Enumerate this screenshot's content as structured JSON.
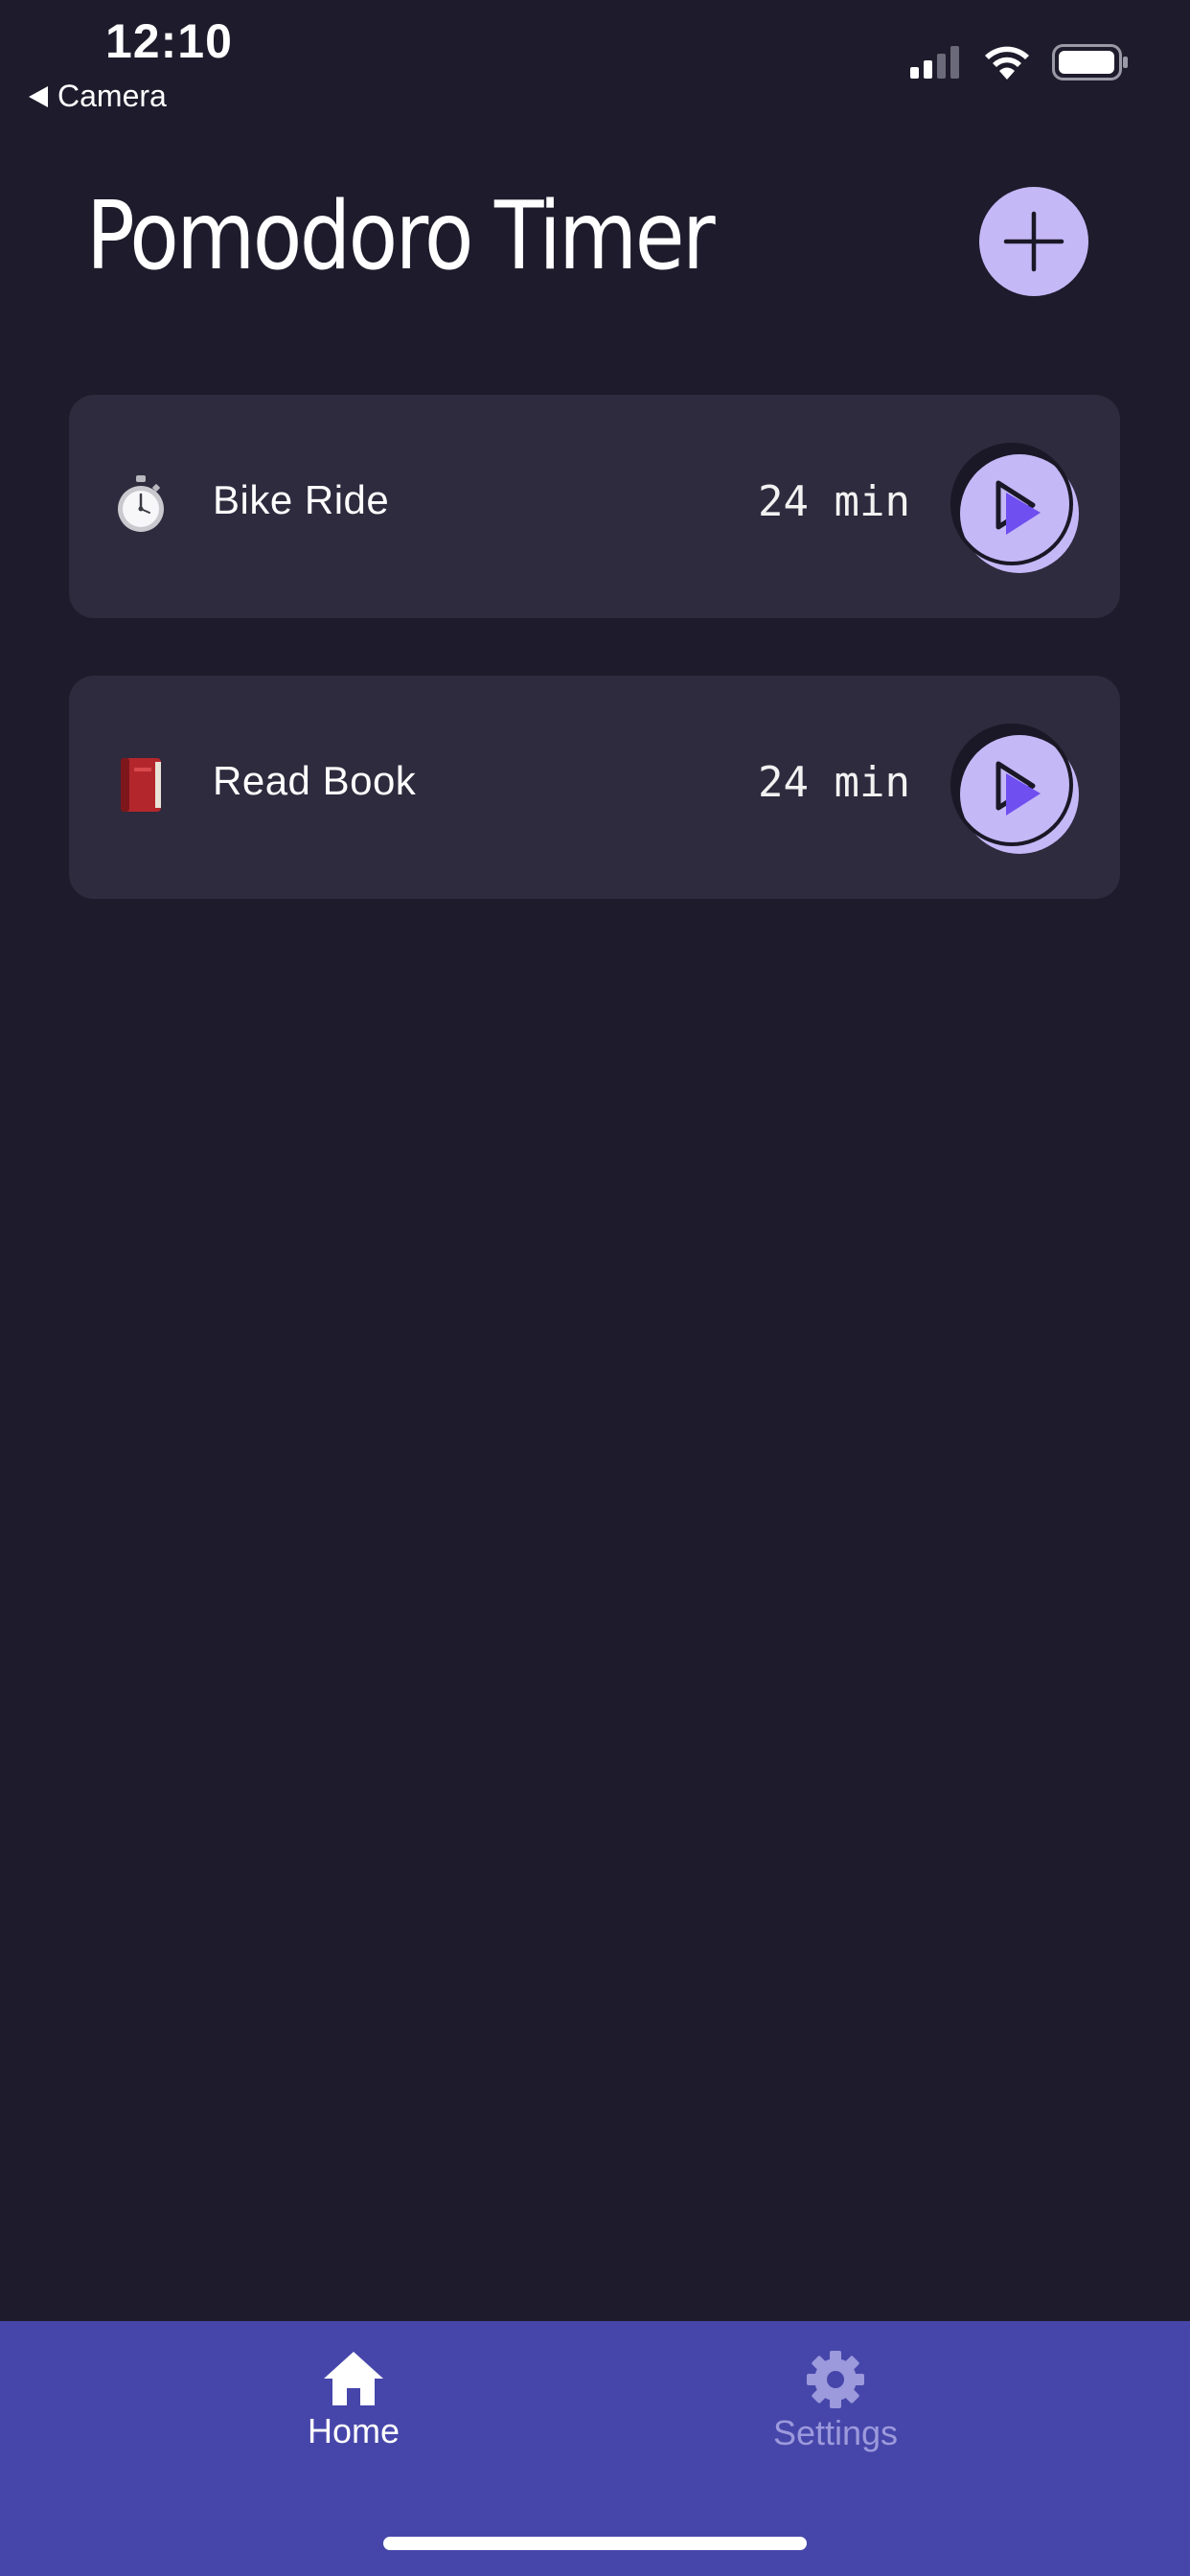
{
  "status_bar": {
    "time": "12:10",
    "back_label": "Camera",
    "icons": [
      "signal-icon",
      "wifi-icon",
      "battery-icon"
    ]
  },
  "header": {
    "title": "Pomodoro Timer",
    "add_icon": "plus-icon"
  },
  "timers": [
    {
      "icon": "stopwatch-icon",
      "label": "Bike Ride",
      "duration": "24 min",
      "action_icon": "play-icon"
    },
    {
      "icon": "red-book-icon",
      "label": "Read Book",
      "duration": "24 min",
      "action_icon": "play-icon"
    }
  ],
  "tab_bar": {
    "tabs": [
      {
        "label": "Home",
        "icon": "home-icon",
        "active": true
      },
      {
        "label": "Settings",
        "icon": "gear-icon",
        "active": false
      }
    ]
  },
  "colors": {
    "background": "#1e1b2c",
    "card": "#2d2b3d",
    "accent": "#c5b8f7",
    "play_triangle": "#6f4ff0",
    "tab_bar": "#4646aa",
    "tab_inactive": "#9c99dc"
  }
}
